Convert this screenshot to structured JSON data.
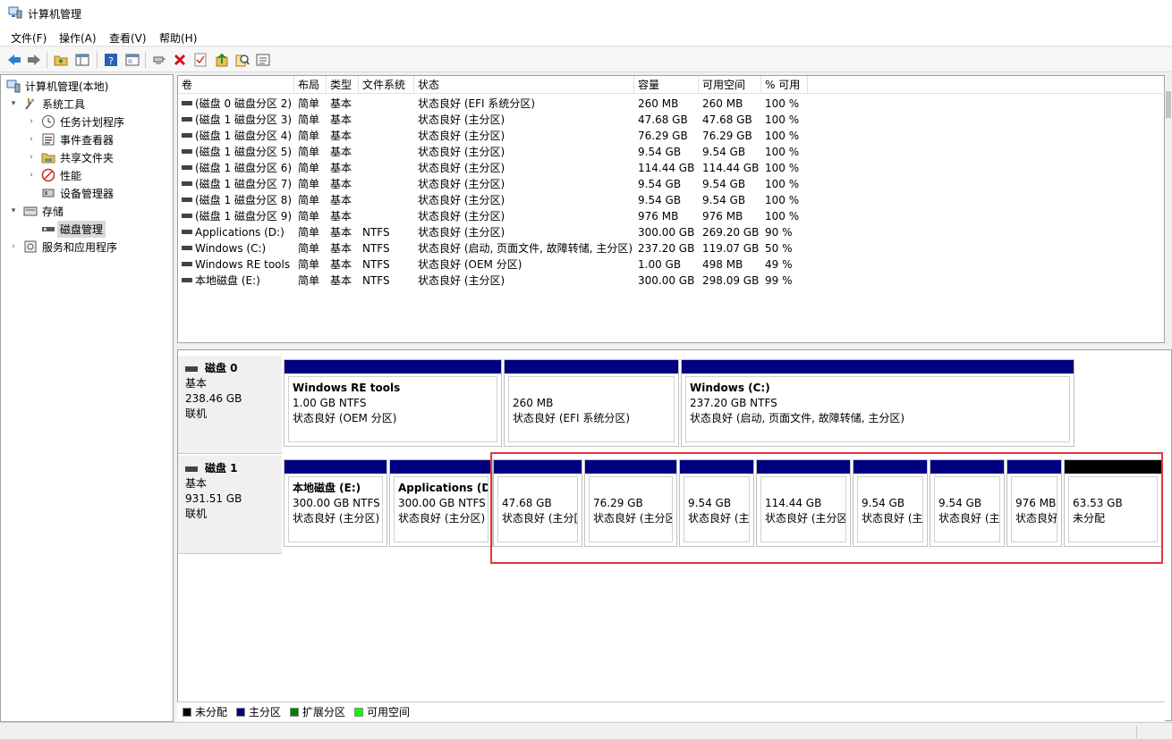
{
  "window": {
    "title": "计算机管理"
  },
  "menu": [
    "文件(F)",
    "操作(A)",
    "查看(V)",
    "帮助(H)"
  ],
  "toolbar": {
    "icons": [
      "back-icon",
      "forward-icon",
      "up-folder-icon",
      "show-hide-tree-icon",
      "help-icon",
      "properties-icon",
      "connect-icon",
      "delete-icon",
      "check-icon",
      "up-arrow-icon",
      "search-icon",
      "list-icon"
    ]
  },
  "tree": [
    {
      "label": "计算机管理(本地)",
      "level": 0,
      "arrow": "",
      "icon": "computer-management-icon"
    },
    {
      "label": "系统工具",
      "level": 1,
      "arrow": "▾",
      "icon": "tools-icon"
    },
    {
      "label": "任务计划程序",
      "level": 2,
      "arrow": "›",
      "icon": "clock-icon"
    },
    {
      "label": "事件查看器",
      "level": 2,
      "arrow": "›",
      "icon": "event-viewer-icon"
    },
    {
      "label": "共享文件夹",
      "level": 2,
      "arrow": "›",
      "icon": "shared-folder-icon"
    },
    {
      "label": "性能",
      "level": 2,
      "arrow": "›",
      "icon": "performance-icon"
    },
    {
      "label": "设备管理器",
      "level": 2,
      "arrow": "",
      "icon": "device-manager-icon"
    },
    {
      "label": "存储",
      "level": 1,
      "arrow": "▾",
      "icon": "storage-icon"
    },
    {
      "label": "磁盘管理",
      "level": 2,
      "arrow": "",
      "icon": "disk-icon",
      "selected": true
    },
    {
      "label": "服务和应用程序",
      "level": 1,
      "arrow": "›",
      "icon": "services-icon"
    }
  ],
  "columns": [
    "卷",
    "布局",
    "类型",
    "文件系统",
    "状态",
    "容量",
    "可用空间",
    "% 可用"
  ],
  "volumes": [
    [
      "(磁盘 0 磁盘分区 2)",
      "简单",
      "基本",
      "",
      "状态良好 (EFI 系统分区)",
      "260 MB",
      "260 MB",
      "100 %"
    ],
    [
      "(磁盘 1 磁盘分区 3)",
      "简单",
      "基本",
      "",
      "状态良好 (主分区)",
      "47.68 GB",
      "47.68 GB",
      "100 %"
    ],
    [
      "(磁盘 1 磁盘分区 4)",
      "简单",
      "基本",
      "",
      "状态良好 (主分区)",
      "76.29 GB",
      "76.29 GB",
      "100 %"
    ],
    [
      "(磁盘 1 磁盘分区 5)",
      "简单",
      "基本",
      "",
      "状态良好 (主分区)",
      "9.54 GB",
      "9.54 GB",
      "100 %"
    ],
    [
      "(磁盘 1 磁盘分区 6)",
      "简单",
      "基本",
      "",
      "状态良好 (主分区)",
      "114.44 GB",
      "114.44 GB",
      "100 %"
    ],
    [
      "(磁盘 1 磁盘分区 7)",
      "简单",
      "基本",
      "",
      "状态良好 (主分区)",
      "9.54 GB",
      "9.54 GB",
      "100 %"
    ],
    [
      "(磁盘 1 磁盘分区 8)",
      "简单",
      "基本",
      "",
      "状态良好 (主分区)",
      "9.54 GB",
      "9.54 GB",
      "100 %"
    ],
    [
      "(磁盘 1 磁盘分区 9)",
      "简单",
      "基本",
      "",
      "状态良好 (主分区)",
      "976 MB",
      "976 MB",
      "100 %"
    ],
    [
      "Applications (D:)",
      "简单",
      "基本",
      "NTFS",
      "状态良好 (主分区)",
      "300.00 GB",
      "269.20 GB",
      "90 %"
    ],
    [
      "Windows (C:)",
      "简单",
      "基本",
      "NTFS",
      "状态良好 (启动, 页面文件, 故障转储, 主分区)",
      "237.20 GB",
      "119.07 GB",
      "50 %"
    ],
    [
      "Windows RE tools",
      "简单",
      "基本",
      "NTFS",
      "状态良好 (OEM 分区)",
      "1.00 GB",
      "498 MB",
      "49 %"
    ],
    [
      "本地磁盘 (E:)",
      "简单",
      "基本",
      "NTFS",
      "状态良好 (主分区)",
      "300.00 GB",
      "298.09 GB",
      "99 %"
    ]
  ],
  "disks": [
    {
      "name": "磁盘 0",
      "type": "基本",
      "size": "238.46 GB",
      "status": "联机",
      "partitions": [
        {
          "name": "Windows RE tools",
          "size": "1.00 GB NTFS",
          "status": "状态良好 (OEM 分区)",
          "kind": "primary"
        },
        {
          "name": "",
          "size": "260 MB",
          "status": "状态良好 (EFI 系统分区)",
          "kind": "primary"
        },
        {
          "name": "Windows  (C:)",
          "size": "237.20 GB NTFS",
          "status": "状态良好 (启动, 页面文件, 故障转储, 主分区)",
          "kind": "primary"
        }
      ]
    },
    {
      "name": "磁盘 1",
      "type": "基本",
      "size": "931.51 GB",
      "status": "联机",
      "partitions": [
        {
          "name": "本地磁盘  (E:)",
          "size": "300.00 GB NTFS",
          "status": "状态良好 (主分区)",
          "kind": "primary"
        },
        {
          "name": "Applications  (D:)",
          "size": "300.00 GB NTFS",
          "status": "状态良好 (主分区)",
          "kind": "primary"
        },
        {
          "name": "",
          "size": "47.68 GB",
          "status": "状态良好 (主分[",
          "kind": "primary"
        },
        {
          "name": "",
          "size": "76.29 GB",
          "status": "状态良好 (主分区",
          "kind": "primary"
        },
        {
          "name": "",
          "size": "9.54 GB",
          "status": "状态良好 (主:",
          "kind": "primary"
        },
        {
          "name": "",
          "size": "114.44 GB",
          "status": "状态良好 (主分区",
          "kind": "primary"
        },
        {
          "name": "",
          "size": "9.54 GB",
          "status": "状态良好 (主:",
          "kind": "primary"
        },
        {
          "name": "",
          "size": "9.54 GB",
          "status": "状态良好 (主:",
          "kind": "primary"
        },
        {
          "name": "",
          "size": "976 MB",
          "status": "状态良好",
          "kind": "primary"
        },
        {
          "name": "",
          "size": "63.53 GB",
          "status": "未分配",
          "kind": "unallocated"
        }
      ]
    }
  ],
  "legend": [
    {
      "label": "未分配",
      "color": "#000000"
    },
    {
      "label": "主分区",
      "color": "#000080"
    },
    {
      "label": "扩展分区",
      "color": "#008000"
    },
    {
      "label": "可用空间",
      "color": "#00ff00"
    }
  ],
  "colors": {
    "primary": "#000080",
    "unallocated": "#000000",
    "highlight": "#e0393e"
  }
}
